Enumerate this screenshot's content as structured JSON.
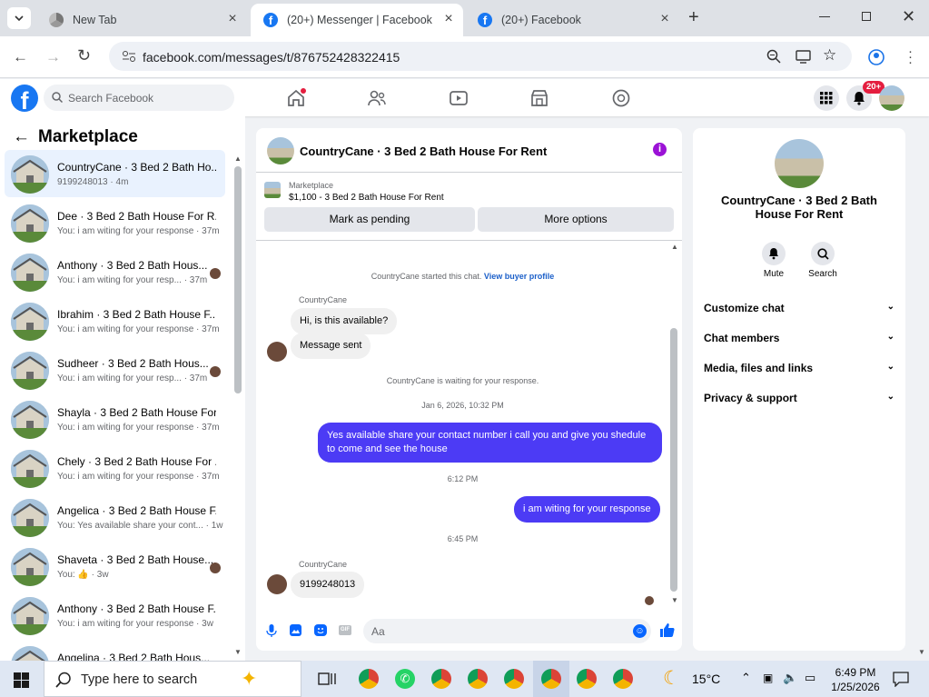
{
  "browser": {
    "tabs": [
      {
        "title": "New Tab",
        "active": false
      },
      {
        "title": "(20+) Messenger | Facebook",
        "active": true
      },
      {
        "title": "(20+) Facebook",
        "active": false
      }
    ],
    "url": "facebook.com/messages/t/876752428322415"
  },
  "fb": {
    "search_placeholder": "Search Facebook",
    "notif_badge": "20+"
  },
  "left": {
    "title": "Marketplace",
    "conversations": [
      {
        "name": "CountryCane · 3 Bed 2 Bath Ho...",
        "preview": "9199248013 · 4m",
        "selected": true,
        "avatar": false
      },
      {
        "name": "Dee · 3 Bed 2 Bath House For R...",
        "preview": "You: i am witing for your response · 37m",
        "avatar": false
      },
      {
        "name": "Anthony · 3 Bed 2 Bath Hous...",
        "preview": "You: i am witing for your resp... · 37m",
        "avatar": true
      },
      {
        "name": "Ibrahim · 3 Bed 2 Bath House F...",
        "preview": "You: i am witing for your response · 37m",
        "avatar": false
      },
      {
        "name": "Sudheer · 3 Bed 2 Bath Hous...",
        "preview": "You: i am witing for your resp... · 37m",
        "avatar": true
      },
      {
        "name": "Shayla · 3 Bed 2 Bath House For...",
        "preview": "You: i am witing for your response · 37m",
        "avatar": false
      },
      {
        "name": "Chely · 3 Bed 2 Bath House For ...",
        "preview": "You: i am witing for your response · 37m",
        "avatar": false
      },
      {
        "name": "Angelica · 3 Bed 2 Bath House F...",
        "preview": "You: Yes available share your cont... · 1w",
        "avatar": false
      },
      {
        "name": "Shaveta · 3 Bed 2 Bath House...",
        "preview": "You: 👍 · 3w",
        "avatar": true
      },
      {
        "name": "Anthony · 3 Bed 2 Bath House F...",
        "preview": "You: i am witing for your response · 3w",
        "avatar": false
      },
      {
        "name": "Angelina · 3 Bed 2 Bath Hous...",
        "preview": "",
        "avatar": false
      }
    ]
  },
  "chat": {
    "title": "CountryCane · 3 Bed 2 Bath House For Rent",
    "marketplace_label": "Marketplace",
    "listing": "$1,100 - 3 Bed 2 Bath House For Rent",
    "pending_btn": "Mark as pending",
    "more_btn": "More options",
    "started_text": "CountryCane started this chat.",
    "buyer_link": "View buyer profile",
    "sender": "CountryCane",
    "msg1": "Hi, is this available?",
    "msg2": "Message sent",
    "waiting": "CountryCane is waiting for your response.",
    "time1": "Jan 6, 2026, 10:32 PM",
    "out1": "Yes available share your contact number i call you and give you shedule to come and see the house",
    "time2": "6:12 PM",
    "out2": "i am witing for your response",
    "time3": "6:45 PM",
    "sender2": "CountryCane",
    "msg3": "9199248013",
    "input_placeholder": "Aa"
  },
  "right": {
    "name": "CountryCane · 3 Bed 2 Bath House For Rent",
    "mute": "Mute",
    "search": "Search",
    "sections": [
      "Customize chat",
      "Chat members",
      "Media, files and links",
      "Privacy & support"
    ]
  },
  "taskbar": {
    "search_placeholder": "Type here to search",
    "temperature": "15°C",
    "time": "6:49 PM",
    "date": "1/25/2026"
  },
  "colors": {
    "fb_blue": "#1877f2",
    "outgoing": "#4c3bf5",
    "selected_row": "#e9f2fe"
  }
}
